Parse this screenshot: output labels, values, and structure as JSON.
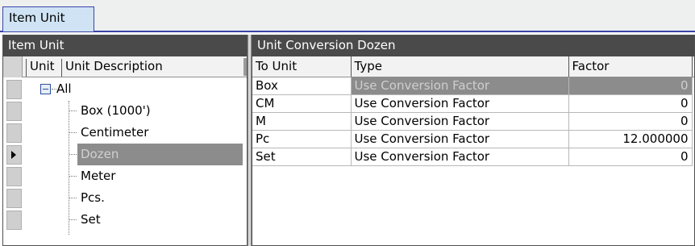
{
  "tab": {
    "label": "Item Unit"
  },
  "left_panel": {
    "title": "Item Unit",
    "columns": [
      "Unit",
      "Unit Description"
    ],
    "tree": {
      "root": "All",
      "children": [
        "Box (1000')",
        "Centimeter",
        "Dozen",
        "Meter",
        "Pcs.",
        "Set"
      ],
      "selected": "Dozen"
    }
  },
  "right_panel": {
    "title": "Unit Conversion Dozen",
    "columns": [
      "To Unit",
      "Type",
      "Factor"
    ],
    "rows": [
      {
        "to_unit": "Box",
        "type": "Use Conversion Factor",
        "factor": "0"
      },
      {
        "to_unit": "CM",
        "type": "Use Conversion Factor",
        "factor": "0"
      },
      {
        "to_unit": "M",
        "type": "Use Conversion Factor",
        "factor": "0"
      },
      {
        "to_unit": "Pc",
        "type": "Use Conversion Factor",
        "factor": "12.000000"
      },
      {
        "to_unit": "Set",
        "type": "Use Conversion Factor",
        "factor": "0"
      }
    ]
  }
}
